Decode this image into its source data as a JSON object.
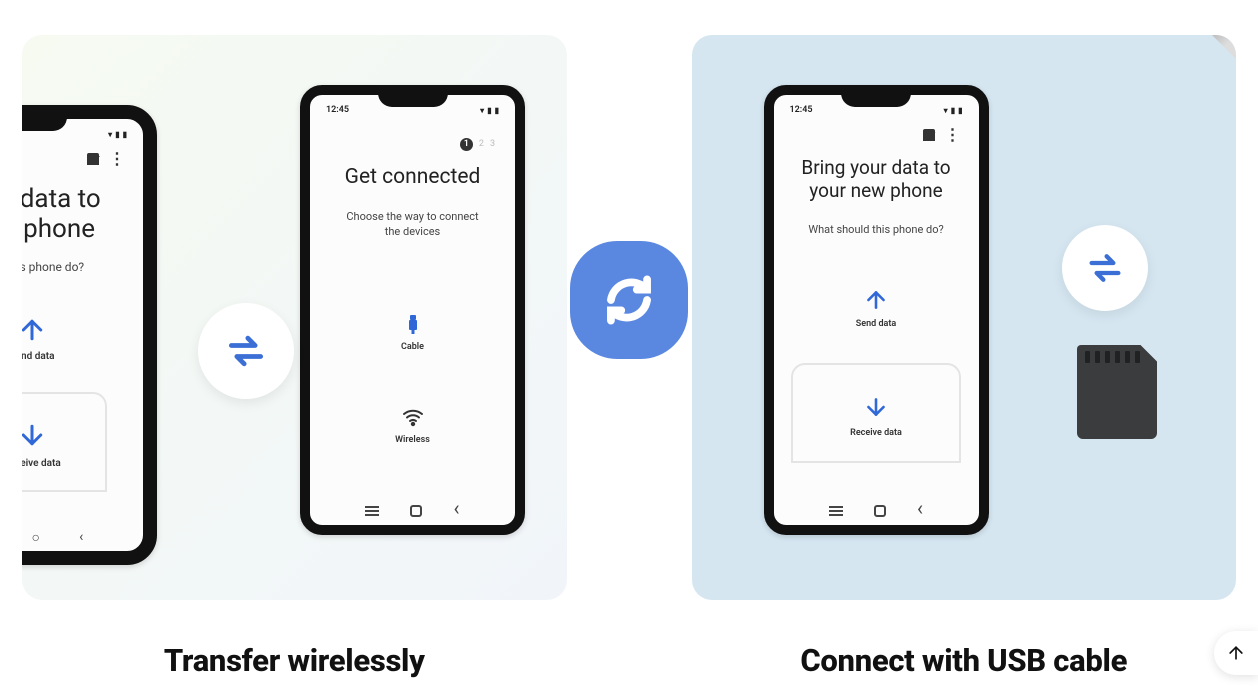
{
  "captions": {
    "left": "Transfer wirelessly",
    "right": "Connect with USB cable"
  },
  "icons": {
    "app": "smart-switch-icon",
    "swap": "swap-arrows-icon",
    "sd": "sd-card-icon"
  },
  "phone_left_a": {
    "time": "",
    "title_line1": "your data to",
    "title_line2": "new phone",
    "subtitle": "ould this phone do?",
    "send_label": "Send data",
    "receive_label": "Receive data"
  },
  "phone_left_b": {
    "time": "12:45",
    "step_active": "1",
    "step_2": "2",
    "step_3": "3",
    "title": "Get connected",
    "subtitle_line1": "Choose the way to connect",
    "subtitle_line2": "the devices",
    "cable_label": "Cable",
    "wireless_label": "Wireless"
  },
  "phone_right": {
    "time": "12:45",
    "title_line1": "Bring your data to",
    "title_line2": "your new phone",
    "subtitle": "What should this phone do?",
    "send_label": "Send data",
    "receive_label": "Receive data"
  }
}
